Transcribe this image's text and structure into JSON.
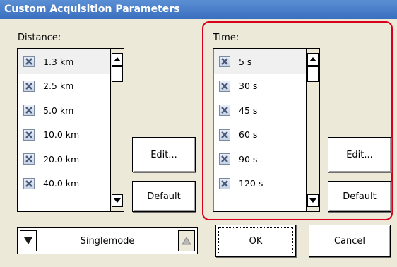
{
  "window": {
    "title": "Custom Acquisition Parameters"
  },
  "distance": {
    "label": "Distance:",
    "items": [
      {
        "label": "1.3 km",
        "checked": true
      },
      {
        "label": "2.5 km",
        "checked": true
      },
      {
        "label": "5.0 km",
        "checked": true
      },
      {
        "label": "10.0 km",
        "checked": true
      },
      {
        "label": "20.0 km",
        "checked": true
      },
      {
        "label": "40.0 km",
        "checked": true
      }
    ],
    "edit_label": "Edit...",
    "default_label": "Default"
  },
  "time": {
    "label": "Time:",
    "items": [
      {
        "label": "5 s",
        "checked": true
      },
      {
        "label": "30 s",
        "checked": true
      },
      {
        "label": "45 s",
        "checked": true
      },
      {
        "label": "60 s",
        "checked": true
      },
      {
        "label": "90 s",
        "checked": true
      },
      {
        "label": "120 s",
        "checked": true
      }
    ],
    "edit_label": "Edit...",
    "default_label": "Default"
  },
  "fiber_mode": {
    "value": "Singlemode"
  },
  "footer": {
    "ok_label": "OK",
    "cancel_label": "Cancel"
  },
  "colors": {
    "titlebar": "#3a6fc0",
    "highlight": "#d9001b",
    "background": "#ece9d8"
  }
}
